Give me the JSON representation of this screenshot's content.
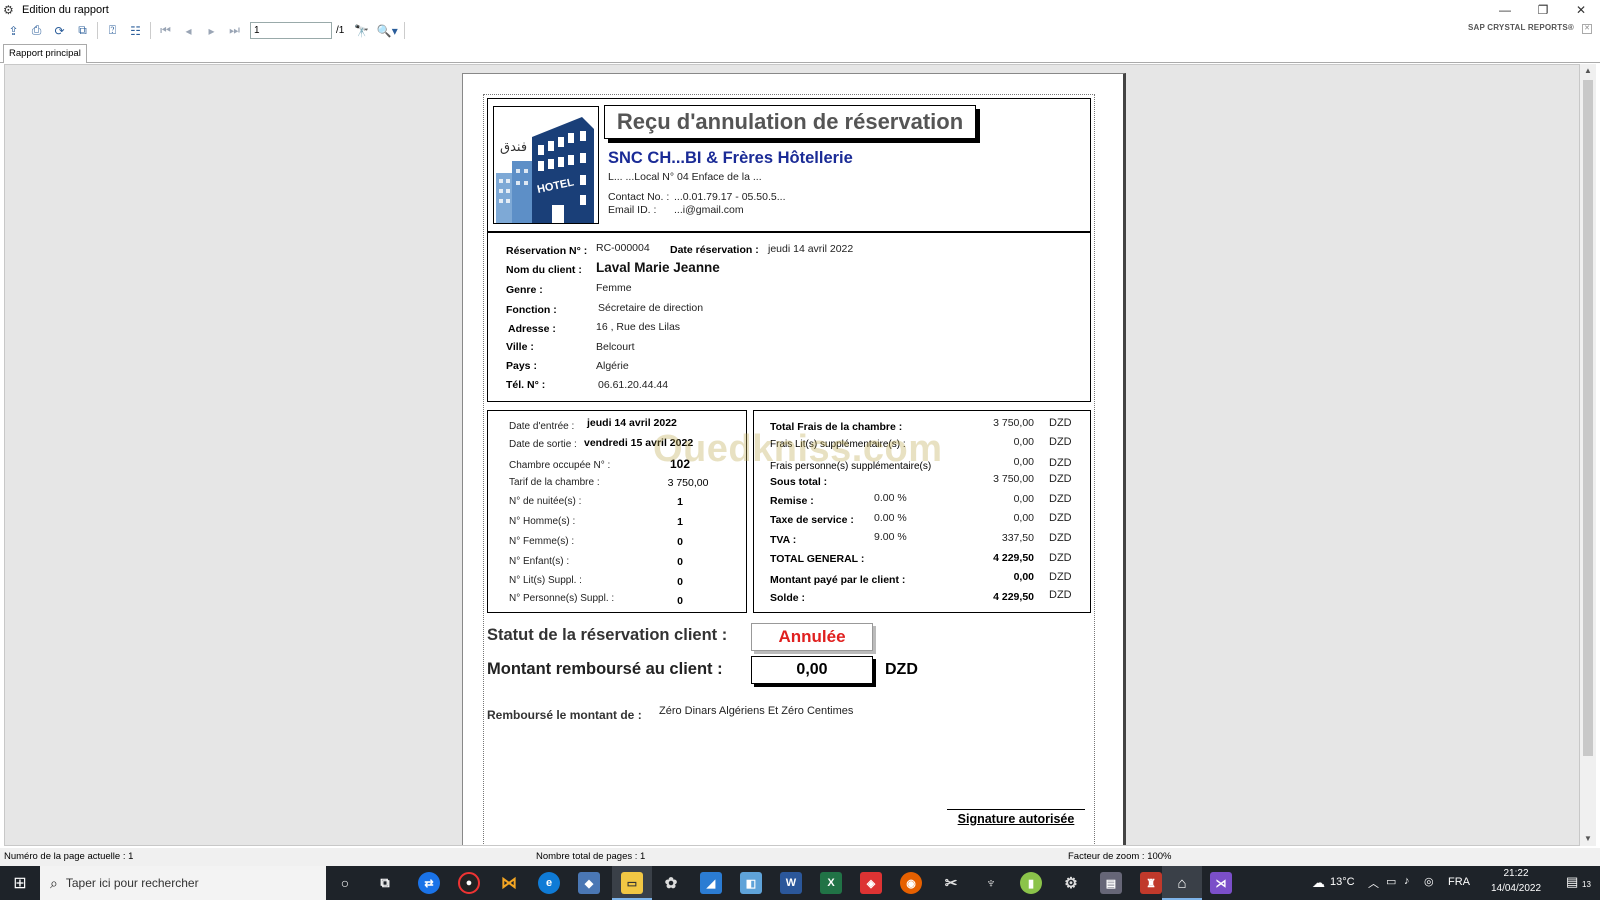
{
  "window": {
    "title": "Edition du rapport"
  },
  "toolbar": {
    "page_value": "1",
    "page_of": "/1",
    "brand": "SAP CRYSTAL REPORTS®"
  },
  "tabs": {
    "main": "Rapport principal"
  },
  "report": {
    "title": "Reçu d'annulation de réservation",
    "logo_text": "HOTEL",
    "logo_arabic": "فندق",
    "company": "SNC CH...BI & Frères Hôtellerie",
    "address": "L... ...Local N° 04 Enface de la ...",
    "contact_label": "Contact No. :",
    "contact_value": "...0.01.79.17 - 05.50.5...",
    "email_label": "Email ID. :",
    "email_value": "...i@gmail.com",
    "client": {
      "reservation_no_label": "Réservation N° :",
      "reservation_no": "RC-000004",
      "reservation_date_label": "Date réservation :",
      "reservation_date": "jeudi 14 avril 2022",
      "name_label": "Nom du client :",
      "name": "Laval Marie Jeanne",
      "genre_label": "Genre :",
      "genre": "Femme",
      "fonction_label": "Fonction :",
      "fonction": "Sécretaire de direction",
      "adresse_label": "Adresse :",
      "adresse": "16 , Rue des Lilas",
      "ville_label": "Ville :",
      "ville": "Belcourt",
      "pays_label": "Pays :",
      "pays": "Algérie",
      "tel_label": "Tél. N° :",
      "tel": "06.61.20.44.44"
    },
    "stay": {
      "entree_label": "Date d'entrée :",
      "entree": "jeudi 14 avril 2022",
      "sortie_label": "Date de sortie :",
      "sortie": "vendredi 15 avril 2022",
      "chambre_label": "Chambre occupée N° :",
      "chambre": "102",
      "tarif_label": "Tarif de la chambre :",
      "tarif": "3 750,00",
      "nuitees_label": "N° de nuitée(s) :",
      "nuitees": "1",
      "hommes_label": "N° Homme(s) :",
      "hommes": "1",
      "femmes_label": "N° Femme(s) :",
      "femmes": "0",
      "enfants_label": "N° Enfant(s) :",
      "enfants": "0",
      "lits_label": "N° Lit(s) Suppl. :",
      "lits": "0",
      "personnes_label": "N° Personne(s) Suppl. :",
      "personnes": "0"
    },
    "totals": {
      "currency": "DZD",
      "frais_chambre_label": "Total Frais de la chambre :",
      "frais_chambre": "3 750,00",
      "lits_supp_label": "Frais Lit(s) supplémentaire(s) :",
      "lits_supp": "0,00",
      "pers_supp_label": "Frais personne(s) supplémentaire(s)",
      "pers_supp": "0,00",
      "sous_total_label": "Sous total :",
      "sous_total": "3 750,00",
      "remise_label": "Remise :",
      "remise_pct": "0.00 %",
      "remise": "0,00",
      "service_label": "Taxe de service :",
      "service_pct": "0.00 %",
      "service": "0,00",
      "tva_label": "TVA :",
      "tva_pct": "9.00 %",
      "tva": "337,50",
      "general_label": "TOTAL GENERAL :",
      "general": "4 229,50",
      "paye_label": "Montant payé par le client :",
      "paye": "0,00",
      "solde_label": "Solde :",
      "solde": "4 229,50"
    },
    "watermark": "Ouedkniss.com",
    "status_label": "Statut de la réservation client :",
    "status_value": "Annulée",
    "refund_label": "Montant remboursé au client :",
    "refund_value": "0,00",
    "refund_currency": "DZD",
    "rembourse_label": "Remboursé  le montant  de  :",
    "rembourse_value": "Zéro Dinars Algériens Et Zéro Centimes",
    "signature": "Signature autorisée"
  },
  "statusbar": {
    "page_current": "Numéro de la page actuelle : 1",
    "page_total": "Nombre total de pages : 1",
    "zoom": "Facteur de zoom : 100%"
  },
  "taskbar": {
    "search_placeholder": "Taper ici pour rechercher",
    "temperature": "13°C",
    "language": "FRA",
    "time": "21:22",
    "date": "14/04/2022",
    "notifications": "13"
  },
  "colors": {
    "company": "#1a2b96",
    "status": "#e0201f",
    "taskbar": "#1e2329"
  }
}
